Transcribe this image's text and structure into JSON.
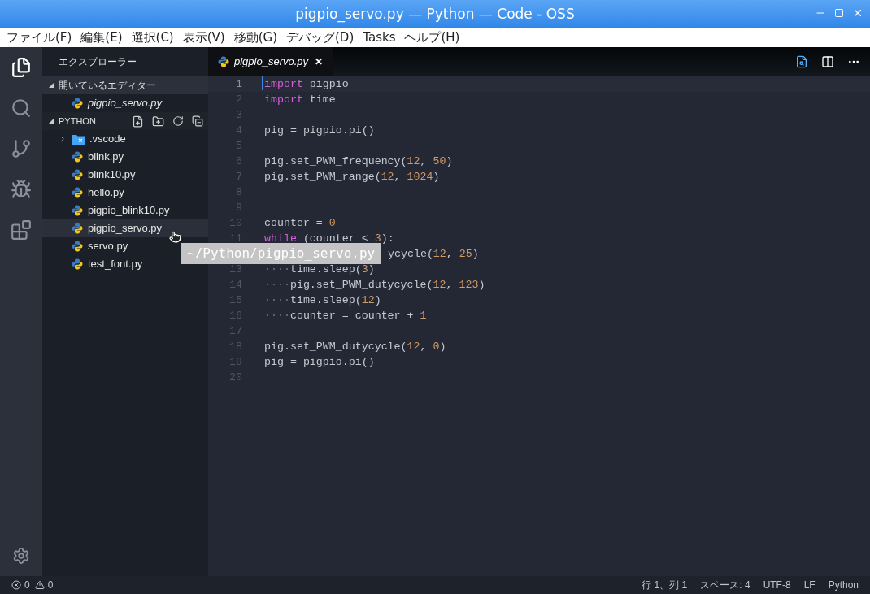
{
  "window": {
    "title": "pigpio_servo.py — Python — Code - OSS"
  },
  "menu": [
    "ファイル(F)",
    "編集(E)",
    "選択(C)",
    "表示(V)",
    "移動(G)",
    "デバッグ(D)",
    "Tasks",
    "ヘルプ(H)"
  ],
  "sidebar": {
    "title": "エクスプローラー",
    "sections": [
      {
        "label": "開いているエディター",
        "kind": "open_editors",
        "expanded": true,
        "items": [
          {
            "name": "pigpio_servo.py",
            "kind": "python",
            "preview": true,
            "selected": false
          }
        ]
      },
      {
        "label": "PYTHON",
        "kind": "folder",
        "expanded": true,
        "items": [
          {
            "name": ".vscode",
            "kind": "folder",
            "expanded": false,
            "preview": false,
            "selected": false
          },
          {
            "name": "blink.py",
            "kind": "python",
            "preview": false,
            "selected": false
          },
          {
            "name": "blink10.py",
            "kind": "python",
            "preview": false,
            "selected": false
          },
          {
            "name": "hello.py",
            "kind": "python",
            "preview": false,
            "selected": false
          },
          {
            "name": "pigpio_blink10.py",
            "kind": "python",
            "preview": false,
            "selected": false
          },
          {
            "name": "pigpio_servo.py",
            "kind": "python",
            "preview": false,
            "selected": true
          },
          {
            "name": "servo.py",
            "kind": "python",
            "preview": false,
            "selected": false
          },
          {
            "name": "test_font.py",
            "kind": "python",
            "preview": false,
            "selected": false
          }
        ]
      }
    ]
  },
  "tabs": [
    {
      "label": "pigpio_servo.py",
      "selected": true,
      "preview": true,
      "close": "✕"
    }
  ],
  "editor": {
    "lines": [
      {
        "number": "1",
        "current": true,
        "kind": "normal",
        "tokens": [
          {
            "text": "import",
            "kind": "keyword"
          },
          {
            "text": " pigpio",
            "kind": "plain"
          }
        ]
      },
      {
        "number": "2",
        "kind": "normal",
        "tokens": [
          {
            "text": "import",
            "kind": "keyword"
          },
          {
            "text": " time",
            "kind": "plain"
          }
        ]
      },
      {
        "number": "3",
        "kind": "normal"
      },
      {
        "number": "4",
        "kind": "normal",
        "tokens": [
          {
            "text": "pig = pigpio.pi()",
            "kind": "plain"
          }
        ]
      },
      {
        "number": "5",
        "kind": "normal"
      },
      {
        "number": "6",
        "kind": "normal",
        "tokens": [
          {
            "text": "pig.set_PWM_frequency(",
            "kind": "plain"
          },
          {
            "text": "12",
            "kind": "number"
          },
          {
            "text": ", ",
            "kind": "plain"
          },
          {
            "text": "50",
            "kind": "number"
          },
          {
            "text": ")",
            "kind": "plain"
          }
        ]
      },
      {
        "number": "7",
        "kind": "normal",
        "tokens": [
          {
            "text": "pig.set_PWM_range(",
            "kind": "plain"
          },
          {
            "text": "12",
            "kind": "number"
          },
          {
            "text": ", ",
            "kind": "plain"
          },
          {
            "text": "1024",
            "kind": "number"
          },
          {
            "text": ")",
            "kind": "plain"
          }
        ]
      },
      {
        "number": "8",
        "kind": "normal"
      },
      {
        "number": "9",
        "kind": "normal"
      },
      {
        "number": "10",
        "kind": "normal",
        "tokens": [
          {
            "text": "counter = ",
            "kind": "plain"
          },
          {
            "text": "0",
            "kind": "number"
          }
        ]
      },
      {
        "number": "11",
        "kind": "normal",
        "tokens": [
          {
            "text": "while",
            "kind": "keyword"
          },
          {
            "text": " (counter < ",
            "kind": "plain"
          },
          {
            "text": "3",
            "kind": "number"
          },
          {
            "text": "):",
            "kind": "plain"
          }
        ]
      },
      {
        "kind": "covered",
        "tokens": [
          {
            "text": "ycycle(",
            "kind": "plain"
          },
          {
            "text": "12",
            "kind": "number"
          },
          {
            "text": ", ",
            "kind": "plain"
          },
          {
            "text": "25",
            "kind": "number"
          },
          {
            "text": ")",
            "kind": "plain"
          }
        ]
      },
      {
        "number": "13",
        "kind": "normal",
        "tokens": [
          {
            "text": "····",
            "kind": "whitespace"
          },
          {
            "text": "time.sleep(",
            "kind": "plain"
          },
          {
            "text": "3",
            "kind": "number"
          },
          {
            "text": ")",
            "kind": "plain"
          }
        ]
      },
      {
        "number": "14",
        "kind": "normal",
        "tokens": [
          {
            "text": "····",
            "kind": "whitespace"
          },
          {
            "text": "pig.set_PWM_dutycycle(",
            "kind": "plain"
          },
          {
            "text": "12",
            "kind": "number"
          },
          {
            "text": ", ",
            "kind": "plain"
          },
          {
            "text": "123",
            "kind": "number"
          },
          {
            "text": ")",
            "kind": "plain"
          }
        ]
      },
      {
        "number": "15",
        "kind": "normal",
        "tokens": [
          {
            "text": "····",
            "kind": "whitespace"
          },
          {
            "text": "time.sleep(",
            "kind": "plain"
          },
          {
            "text": "12",
            "kind": "number"
          },
          {
            "text": ")",
            "kind": "plain"
          }
        ]
      },
      {
        "number": "16",
        "kind": "normal",
        "tokens": [
          {
            "text": "····",
            "kind": "whitespace"
          },
          {
            "text": "counter = counter + ",
            "kind": "plain"
          },
          {
            "text": "1",
            "kind": "number"
          }
        ]
      },
      {
        "number": "17",
        "kind": "normal"
      },
      {
        "number": "18",
        "kind": "normal",
        "tokens": [
          {
            "text": "pig.set_PWM_dutycycle(",
            "kind": "plain"
          },
          {
            "text": "12",
            "kind": "number"
          },
          {
            "text": ", ",
            "kind": "plain"
          },
          {
            "text": "0",
            "kind": "number"
          },
          {
            "text": ")",
            "kind": "plain"
          }
        ]
      },
      {
        "number": "19",
        "kind": "normal",
        "tokens": [
          {
            "text": "pig = pigpio.pi()",
            "kind": "plain"
          }
        ]
      },
      {
        "number": "20",
        "kind": "normal"
      }
    ]
  },
  "tooltip": {
    "text": "~/Python/pigpio_servo.py"
  },
  "status_bar": {
    "errors": "0",
    "warnings": "0",
    "items": [
      "行 1、列 1",
      "スペース: 4",
      "UTF-8",
      "LF",
      "Python"
    ]
  }
}
